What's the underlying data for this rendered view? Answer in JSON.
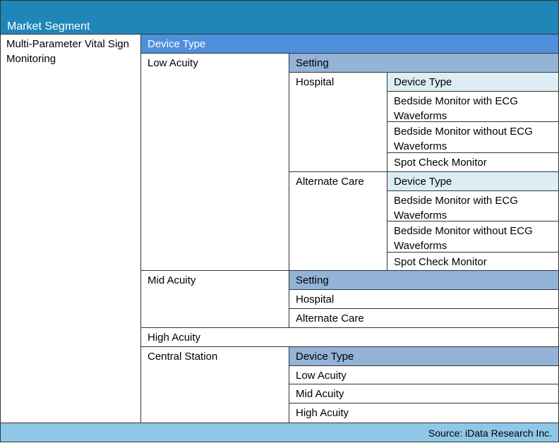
{
  "title": "Market Segment",
  "segment": "Multi-Parameter Vital Sign Monitoring",
  "device_type_header": "Device Type",
  "low_acuity": {
    "label": "Low Acuity",
    "setting_header": "Setting",
    "hospital": {
      "label": "Hospital",
      "header": "Device Type",
      "items": [
        "Bedside Monitor with ECG Waveforms",
        "Bedside Monitor without ECG Waveforms",
        "Spot Check Monitor"
      ]
    },
    "alternate_care": {
      "label": "Alternate Care",
      "header": "Device Type",
      "items": [
        "Bedside Monitor with ECG Waveforms",
        "Bedside Monitor without ECG Waveforms",
        "Spot Check Monitor"
      ]
    }
  },
  "mid_acuity": {
    "label": "Mid Acuity",
    "setting_header": "Setting",
    "items": [
      "Hospital",
      "Alternate Care"
    ]
  },
  "high_acuity": {
    "label": "High Acuity"
  },
  "central_station": {
    "label": "Central Station",
    "header": "Device Type",
    "items": [
      "Low Acuity",
      "Mid Acuity",
      "High Acuity"
    ]
  },
  "source": "Source: iData Research Inc.",
  "colors": {
    "title_bg": "#1f86b8",
    "device_type_bg": "#4f90dc",
    "setting_bg": "#93b3d7",
    "subheader_bg": "#dcedf4",
    "footer_bg": "#8fc8e6"
  }
}
